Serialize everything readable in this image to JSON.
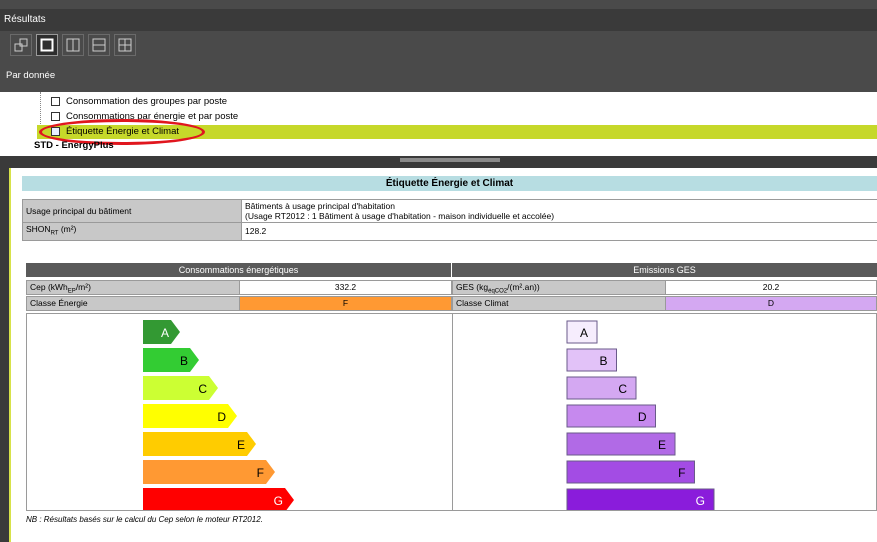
{
  "window": {
    "title": "Résultats"
  },
  "toolbar": {
    "buttons": [
      "layout-single-icon",
      "layout-full-icon",
      "layout-vertical-split-icon",
      "layout-horizontal-split-icon",
      "layout-quad-icon"
    ]
  },
  "section": {
    "label": "Par donnée"
  },
  "tree": {
    "items": [
      {
        "label": "Consommation des groupes par poste"
      },
      {
        "label": "Consommations par énergie et par poste"
      },
      {
        "label": "Étiquette Énergie et Climat"
      }
    ],
    "group_label": "STD - EnergyPlus"
  },
  "panel": {
    "title": "Étiquette Énergie et Climat",
    "usage_label": "Usage principal du bâtiment",
    "usage_value_1": "Bâtiments à usage principal d'habitation",
    "usage_value_2": "(Usage RT2012 : 1 Bâtiment à usage d'habitation - maison individuelle et accolée)",
    "shon_label": "SHON",
    "shon_sub": "RT",
    "shon_unit": " (m²)",
    "shon_value": "128.2",
    "conso_header": "Consommations énergétiques",
    "ges_header": "Emissions GES",
    "cep_label": "Cep (kWh",
    "cep_sub": "EP",
    "cep_unit": "/m²)",
    "cep_value": "332.2",
    "ges_label": "GES (kg",
    "ges_sub": "éqCO2",
    "ges_unit": "/(m².an))",
    "ges_value": "20.2",
    "classe_energie_label": "Classe Énergie",
    "classe_energie_value": "F",
    "classe_climat_label": "Classe Climat",
    "classe_climat_value": "D",
    "note": "NB : Résultats basés sur le calcul du Cep selon le moteur RT2012."
  },
  "energy_scale": [
    {
      "letter": "A",
      "color": "#339933"
    },
    {
      "letter": "B",
      "color": "#33cc33"
    },
    {
      "letter": "C",
      "color": "#ccff33"
    },
    {
      "letter": "D",
      "color": "#ffff00"
    },
    {
      "letter": "E",
      "color": "#ffcc00"
    },
    {
      "letter": "F",
      "color": "#ff9933"
    },
    {
      "letter": "G",
      "color": "#ff0000"
    }
  ],
  "ges_scale": [
    {
      "letter": "A",
      "color": "#f6edfd"
    },
    {
      "letter": "B",
      "color": "#e2c2f8"
    },
    {
      "letter": "C",
      "color": "#d4a8f2"
    },
    {
      "letter": "D",
      "color": "#c689ee"
    },
    {
      "letter": "E",
      "color": "#b16ae6"
    },
    {
      "letter": "F",
      "color": "#a34ce4"
    },
    {
      "letter": "G",
      "color": "#8a1cdb"
    }
  ],
  "colors": {
    "highlight": "#c6d82a",
    "energy_class": "#ff9933",
    "climat_class": "#d4a8f2"
  }
}
